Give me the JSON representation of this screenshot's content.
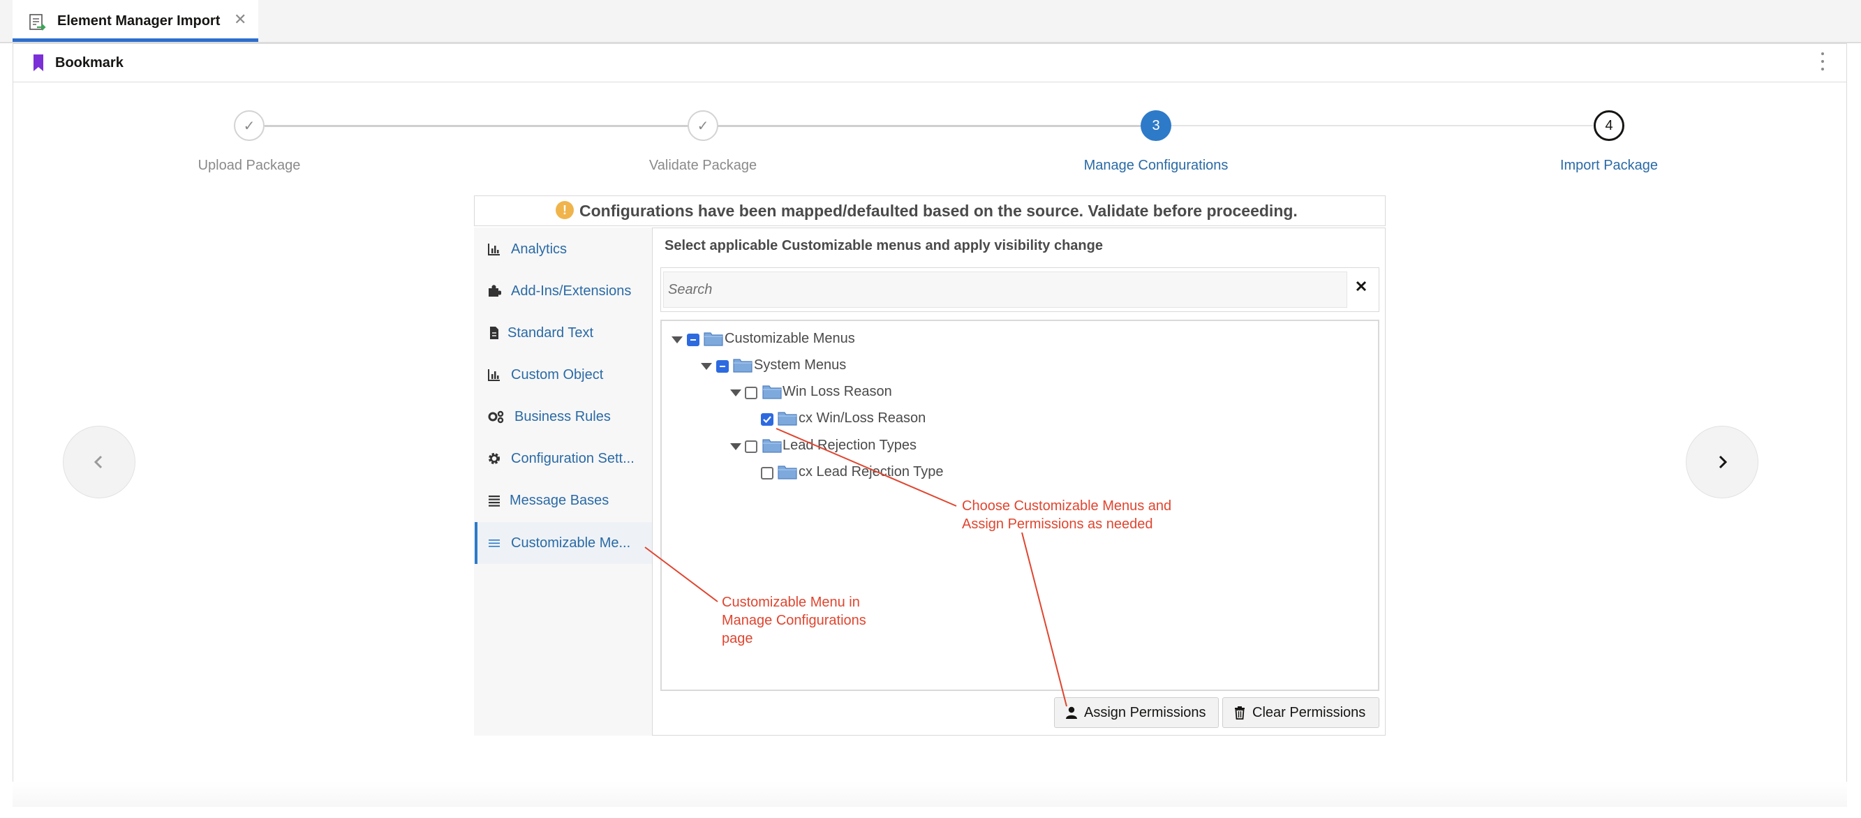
{
  "tab": {
    "title": "Element Manager Import",
    "close": "✕"
  },
  "bookmark": {
    "label": "Bookmark"
  },
  "stepper": {
    "steps": [
      {
        "label": "Upload Package",
        "state": "done",
        "marker": "✓"
      },
      {
        "label": "Validate Package",
        "state": "done",
        "marker": "✓"
      },
      {
        "label": "Manage Configurations",
        "state": "current",
        "marker": "3"
      },
      {
        "label": "Import Package",
        "state": "future",
        "marker": "4"
      }
    ]
  },
  "banner": {
    "icon": "warning-icon",
    "icon_glyph": "!",
    "text": "Configurations have been mapped/defaulted based on the source. Validate before proceeding."
  },
  "leftnav": {
    "items": [
      {
        "label": "Analytics",
        "icon": "chart-icon"
      },
      {
        "label": "Add-Ins/Extensions",
        "icon": "puzzle-icon"
      },
      {
        "label": "Standard Text",
        "icon": "document-icon"
      },
      {
        "label": "Custom Object",
        "icon": "chart-icon"
      },
      {
        "label": "Business Rules",
        "icon": "gears-icon"
      },
      {
        "label": "Configuration Sett...",
        "icon": "gear-icon"
      },
      {
        "label": "Message Bases",
        "icon": "list-icon"
      },
      {
        "label": "Customizable Me...",
        "icon": "menu-icon",
        "selected": true
      }
    ]
  },
  "content": {
    "heading": "Select applicable Customizable menus and apply visibility change",
    "search": {
      "placeholder": "Search",
      "value": ""
    }
  },
  "tree": {
    "nodes": [
      {
        "label": "Customizable Menus",
        "state": "partial",
        "expanded": true,
        "level": 0
      },
      {
        "label": "System Menus",
        "state": "partial",
        "expanded": true,
        "level": 1
      },
      {
        "label": "Win Loss Reason",
        "state": "unchecked",
        "expanded": true,
        "level": 2
      },
      {
        "label": "cx Win/Loss Reason",
        "state": "checked",
        "level": 3
      },
      {
        "label": "Lead Rejection Types",
        "state": "unchecked",
        "expanded": true,
        "level": 2
      },
      {
        "label": "cx Lead Rejection Type",
        "state": "unchecked",
        "level": 3
      }
    ]
  },
  "buttons": {
    "assign": "Assign Permissions",
    "clear": "Clear Permissions"
  },
  "annotations": {
    "tree_note": [
      "Choose Customizable Menus and",
      "Assign Permissions as needed"
    ],
    "nav_note": [
      "Customizable Menu in",
      "Manage Configurations",
      "page"
    ],
    "color": "#e0452f"
  },
  "colors": {
    "accent": "#2d7ac9",
    "link": "#2a6aa6",
    "warning": "#f0b44c",
    "bookmark": "#7b2fd6"
  }
}
